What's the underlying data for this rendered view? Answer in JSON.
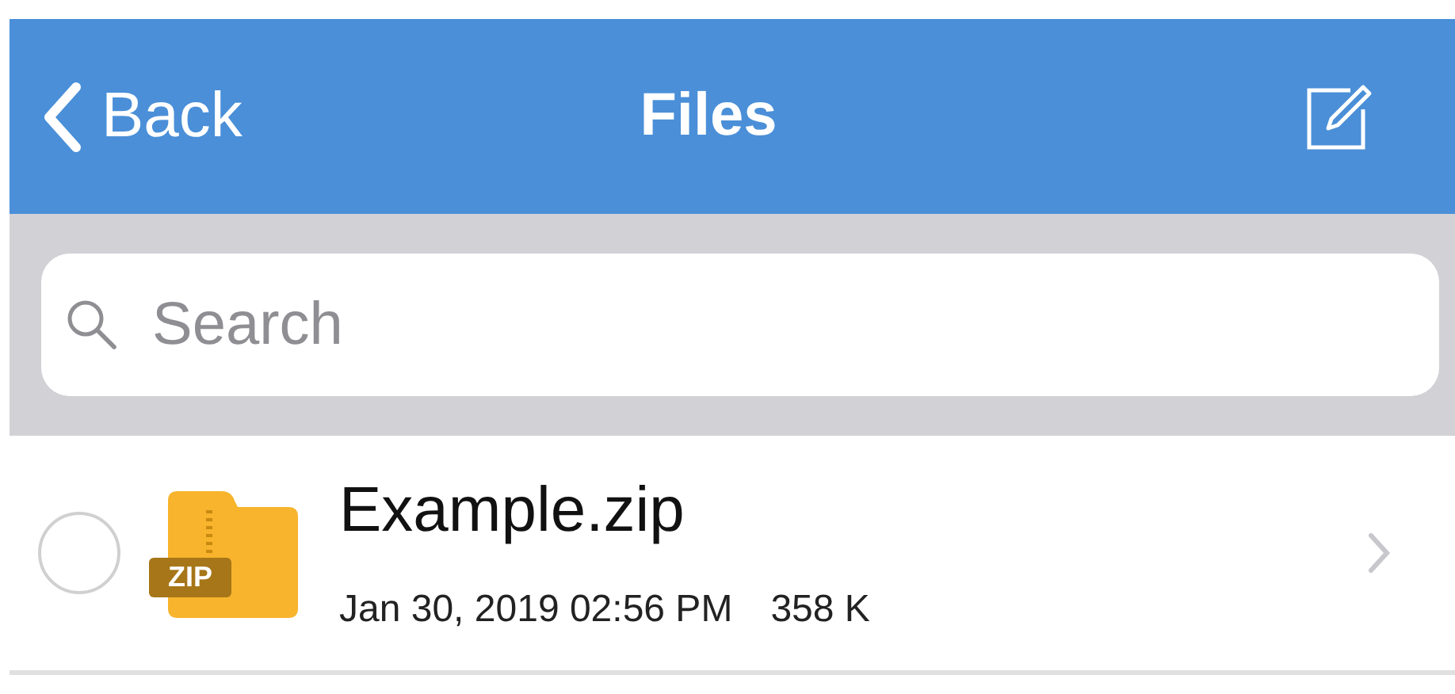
{
  "nav_bar": {
    "back_label": "Back",
    "title": "Files"
  },
  "search": {
    "placeholder": "Search"
  },
  "files": [
    {
      "name": "Example.zip",
      "badge": "ZIP",
      "date": "Jan 30, 2019 02:56 PM",
      "size": "358 K",
      "selected": false
    }
  ]
}
